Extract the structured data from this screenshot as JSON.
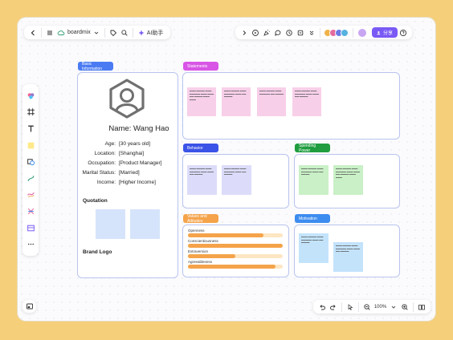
{
  "toolbar": {
    "app_name": "boardmix",
    "ai_label": "AI助手",
    "share_label": "分享"
  },
  "zoom": {
    "level": "100%"
  },
  "cards": {
    "basic": {
      "tag": "Basic Information",
      "tag_color": "#4a7bf3"
    },
    "statements": {
      "tag": "Statements",
      "tag_color": "#d855e6"
    },
    "behavior": {
      "tag": "Behavior",
      "tag_color": "#3b53e6"
    },
    "spending": {
      "tag": "Spending Power",
      "tag_color": "#1f9d3f"
    },
    "values": {
      "tag": "Values and Attitudes",
      "tag_color": "#f5a34a"
    },
    "motivation": {
      "tag": "Motivation",
      "tag_color": "#3d8cf0"
    }
  },
  "persona": {
    "name": "Name: Wang Hao",
    "rows": [
      {
        "label": "Age:",
        "value": "[30 years old]"
      },
      {
        "label": "Location:",
        "value": "[Shanghai]"
      },
      {
        "label": "Occupation:",
        "value": "[Product Manager]"
      },
      {
        "label": "Marital Status:",
        "value": "[Married]"
      },
      {
        "label": "Income:",
        "value": "[Higher Income]"
      }
    ],
    "quotation": "Quotation",
    "brand_logo": "Brand Logo"
  },
  "traits": [
    {
      "label": "Openness",
      "level": 0.8
    },
    {
      "label": "Conscientiousness",
      "level": 1.0
    },
    {
      "label": "Extraversion",
      "level": 0.5
    },
    {
      "label": "Agreeableness",
      "level": 0.92
    }
  ],
  "colors": {
    "pink": "#f7cfe9",
    "lavender": "#dcdcfa",
    "green": "#c9f0c6",
    "blue": "#c3e3fb",
    "quote": "#d6e4fb"
  }
}
